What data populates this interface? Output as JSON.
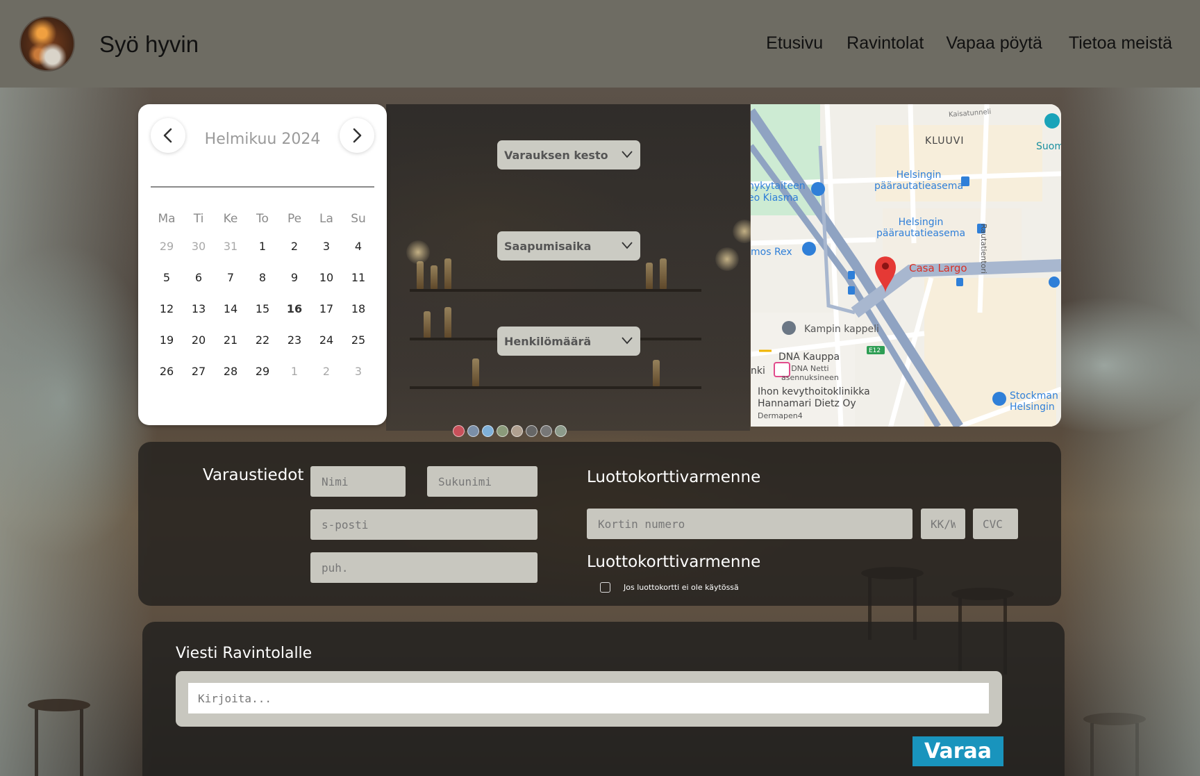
{
  "header": {
    "brand": "Syö hyvin",
    "nav": [
      "Etusivu",
      "Ravintolat",
      "Vapaa pöytä",
      "Tietoa meistä"
    ]
  },
  "calendar": {
    "title": "Helmikuu 2024",
    "weekdays": [
      "Ma",
      "Ti",
      "Ke",
      "To",
      "Pe",
      "La",
      "Su"
    ],
    "days": [
      {
        "d": "29",
        "m": true
      },
      {
        "d": "30",
        "m": true
      },
      {
        "d": "31",
        "m": true
      },
      {
        "d": "1"
      },
      {
        "d": "2"
      },
      {
        "d": "3"
      },
      {
        "d": "4"
      },
      {
        "d": "5"
      },
      {
        "d": "6"
      },
      {
        "d": "7"
      },
      {
        "d": "8"
      },
      {
        "d": "9"
      },
      {
        "d": "10"
      },
      {
        "d": "11"
      },
      {
        "d": "12"
      },
      {
        "d": "13"
      },
      {
        "d": "14"
      },
      {
        "d": "15"
      },
      {
        "d": "16",
        "today": true
      },
      {
        "d": "17"
      },
      {
        "d": "18"
      },
      {
        "d": "19"
      },
      {
        "d": "20"
      },
      {
        "d": "21"
      },
      {
        "d": "22"
      },
      {
        "d": "23"
      },
      {
        "d": "24"
      },
      {
        "d": "25"
      },
      {
        "d": "26"
      },
      {
        "d": "27"
      },
      {
        "d": "28"
      },
      {
        "d": "29"
      },
      {
        "d": "1",
        "m": true
      },
      {
        "d": "2",
        "m": true
      },
      {
        "d": "3",
        "m": true
      }
    ]
  },
  "selects": {
    "duration": "Varauksen kesto",
    "arrival": "Saapumisaika",
    "people": "Henkilömäärä"
  },
  "map": {
    "labels": {
      "kluuvi": "KLUUVI",
      "kaisatunneli": "Kaisatunneli",
      "suom": "Suom",
      "station1": "Helsingin\npäärautatieasema",
      "station2": "Helsingin\npäärautatieasema",
      "kiasma": "nykytaiteen\neo Kiasma",
      "amos": "mos Rex",
      "casa_largo": "Casa Largo",
      "rautatientori": "Rautatientori",
      "kampin": "Kampin kappeli",
      "e12": "E12",
      "dna": "DNA Kauppa",
      "dna_netti": "DNA Netti\nasennuksineen",
      "nki": "nki",
      "ihon": "Ihon kevythoitoklinikka\nHannamari Dietz Oy",
      "dermapen": "Dermapen4",
      "stockmann": "Stockman\nHelsingin"
    },
    "colors": {
      "road": "#8fa3c2",
      "marker": "#e53935",
      "accent_blue": "#2f7fd8",
      "park": "#cdebd3",
      "district": "#f7eedb"
    }
  },
  "reservation": {
    "title": "Varaustiedot",
    "first_name_placeholder": "Nimi",
    "last_name_placeholder": "Sukunimi",
    "email_placeholder": "s-posti",
    "phone_placeholder": "puh.",
    "cc_title": "Luottokorttivarmenne",
    "card_number_placeholder": "Kortin numero",
    "expiry_placeholder": "KK/W",
    "cvc_placeholder": "CVC",
    "cc_title_2": "Luottokorttivarmenne",
    "no_card_label": "Jos luottokortti ei ole käytössä"
  },
  "message": {
    "title": "Viesti Ravintolalle",
    "placeholder": "Kirjoita...",
    "submit_label": "Varaa"
  },
  "colors": {
    "header_bg": "#6e6c63",
    "submit_bg": "#1994bd",
    "field_bg": "#c8c7bf"
  }
}
